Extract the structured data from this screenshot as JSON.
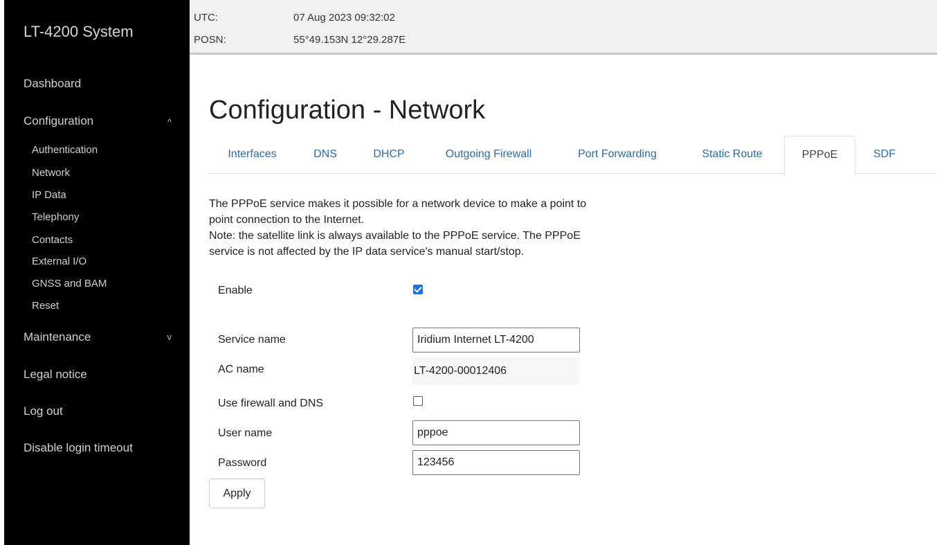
{
  "sidebar": {
    "brand": "LT-4200 System",
    "dashboard": "Dashboard",
    "configuration": "Configuration",
    "configuration_chevron": "^",
    "config_items": [
      "Authentication",
      "Network",
      "IP Data",
      "Telephony",
      "Contacts",
      "External I/O",
      "GNSS and BAM",
      "Reset"
    ],
    "maintenance": "Maintenance",
    "maintenance_chevron": "v",
    "legal_notice": "Legal notice",
    "log_out": "Log out",
    "disable_login_timeout": "Disable login timeout"
  },
  "status": {
    "utc_label": "UTC:",
    "utc_value": "07 Aug 2023 09:32:02",
    "posn_label": "POSN:",
    "posn_value": "55°49.153N 12°29.287E"
  },
  "page": {
    "title": "Configuration - Network",
    "tabs": [
      "Interfaces",
      "DNS",
      "DHCP",
      "Outgoing Firewall",
      "Port Forwarding",
      "Static Route",
      "PPPoE",
      "SDF"
    ],
    "active_tab": "PPPoE",
    "description_line1": "The PPPoE service makes it possible for a network device to make a point to",
    "description_line2": "point connection to the Internet.",
    "description_line3": "Note: the satellite link is always available to the PPPoE service. The PPPoE",
    "description_line4": "service is not affected by the IP data service's manual start/stop."
  },
  "form": {
    "enable_label": "Enable",
    "enable_checked": true,
    "service_name_label": "Service name",
    "service_name_value": "Iridium Internet LT-4200",
    "ac_name_label": "AC name",
    "ac_name_value": "LT-4200-00012406",
    "use_firewall_label": "Use firewall and DNS",
    "use_firewall_checked": false,
    "user_name_label": "User name",
    "user_name_value": "pppoe",
    "password_label": "Password",
    "password_value": "123456",
    "apply_label": "Apply"
  }
}
